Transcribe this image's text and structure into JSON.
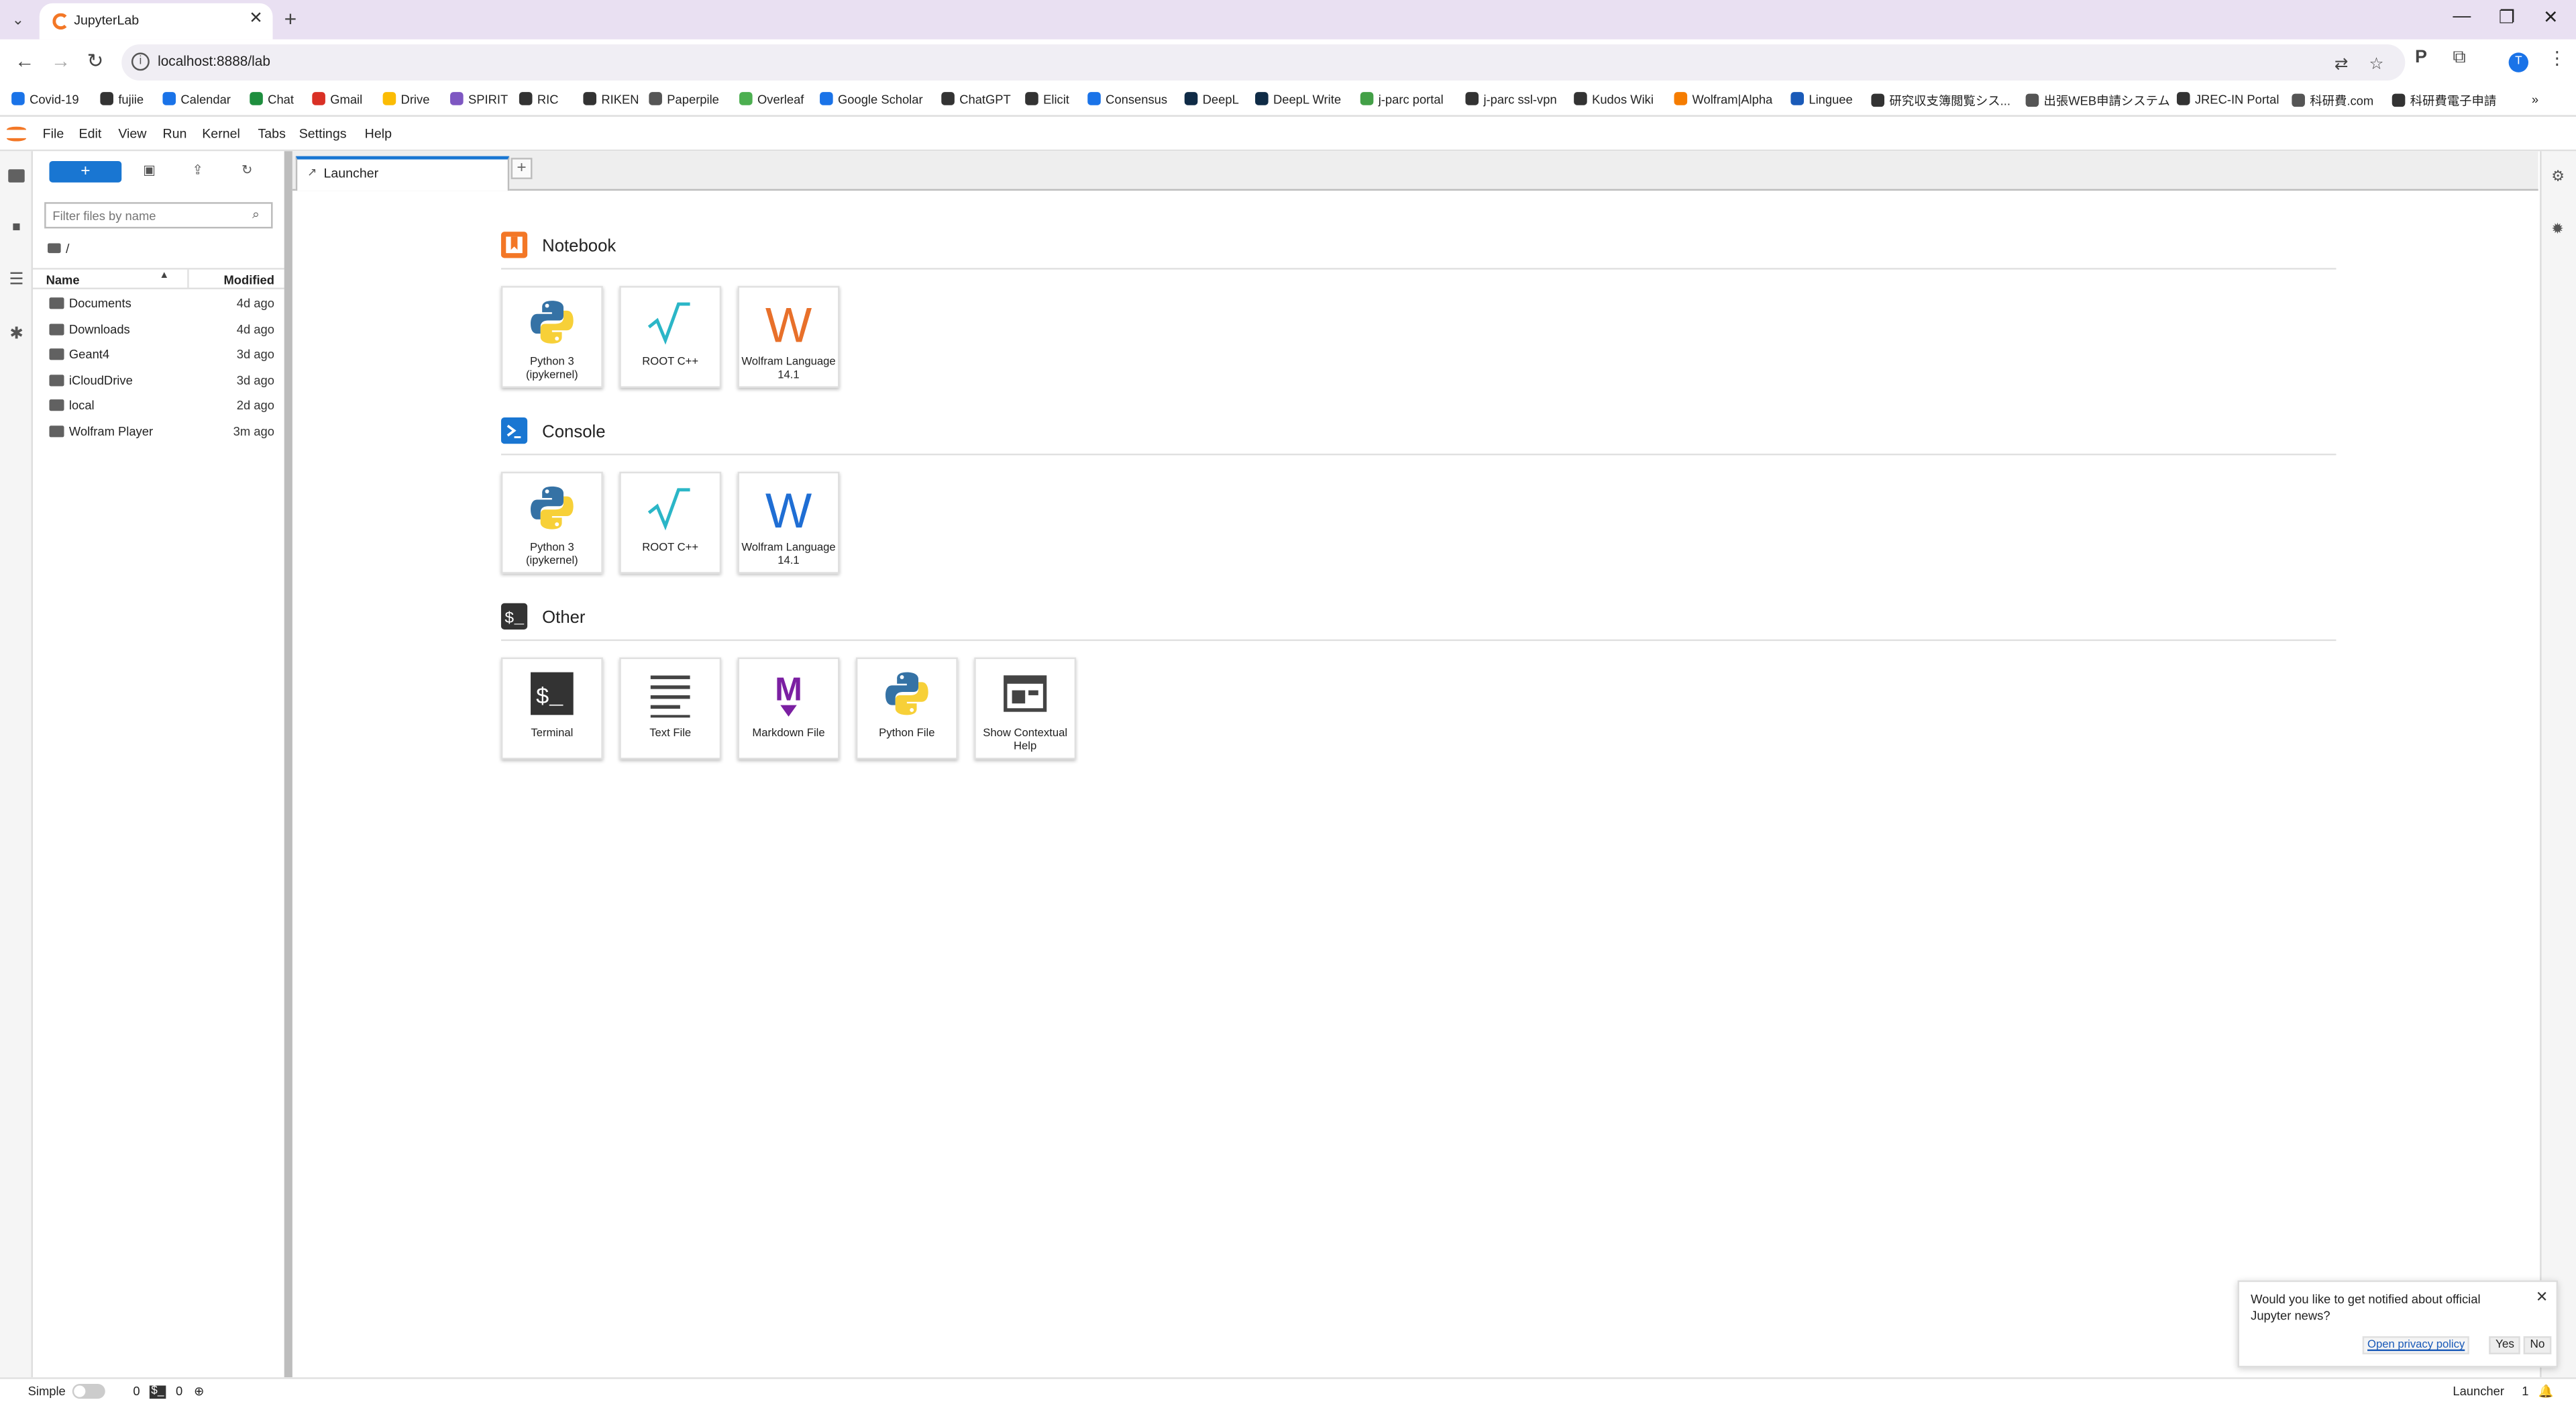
{
  "browser": {
    "tab_title": "JupyterLab",
    "url": "localhost:8888/lab",
    "profile_initial": "T",
    "bookmarks": [
      "Covid-19",
      "fujiie",
      "Calendar",
      "Chat",
      "Gmail",
      "Drive",
      "SPIRIT",
      "RIC",
      "RIKEN",
      "Paperpile",
      "Overleaf",
      "Google Scholar",
      "ChatGPT",
      "Elicit",
      "Consensus",
      "DeepL",
      "DeepL Write",
      "j-parc portal",
      "j-parc ssl-vpn",
      "Kudos Wiki",
      "Wolfram|Alpha",
      "Linguee",
      "研究収支簿閲覧シス...",
      "出張WEB申請システム",
      "JREC-IN Portal",
      "科研費.com",
      "科研費電子申請"
    ]
  },
  "menu": [
    "File",
    "Edit",
    "View",
    "Run",
    "Kernel",
    "Tabs",
    "Settings",
    "Help"
  ],
  "filebrowser": {
    "filter_placeholder": "Filter files by name",
    "breadcrumb": "/",
    "col_name": "Name",
    "col_modified": "Modified",
    "files": [
      {
        "name": "Documents",
        "modified": "4d ago"
      },
      {
        "name": "Downloads",
        "modified": "4d ago"
      },
      {
        "name": "Geant4",
        "modified": "3d ago"
      },
      {
        "name": "iCloudDrive",
        "modified": "3d ago"
      },
      {
        "name": "local",
        "modified": "2d ago"
      },
      {
        "name": "Wolfram Player",
        "modified": "3m ago"
      }
    ]
  },
  "dock": {
    "tab_label": "Launcher"
  },
  "launcher": {
    "notebook": {
      "title": "Notebook",
      "cards": [
        "Python 3 (ipykernel)",
        "ROOT C++",
        "Wolfram Language 14.1"
      ]
    },
    "console": {
      "title": "Console",
      "cards": [
        "Python 3 (ipykernel)",
        "ROOT C++",
        "Wolfram Language 14.1"
      ]
    },
    "other": {
      "title": "Other",
      "cards": [
        "Terminal",
        "Text File",
        "Markdown File",
        "Python File",
        "Show Contextual Help"
      ]
    }
  },
  "notification": {
    "message": "Would you like to get notified about official Jupyter news?",
    "privacy_link": "Open privacy policy",
    "yes": "Yes",
    "no": "No"
  },
  "status": {
    "mode": "Simple",
    "kernels": "0",
    "terminals": "0",
    "active_tab": "Launcher",
    "count": "1"
  },
  "colors": {
    "accent": "#1976d2",
    "jupyter_orange": "#f37726",
    "wolfram_orange": "#e8702a",
    "wolfram_blue": "#1f6ed4",
    "markdown_purple": "#7b1fa2"
  }
}
